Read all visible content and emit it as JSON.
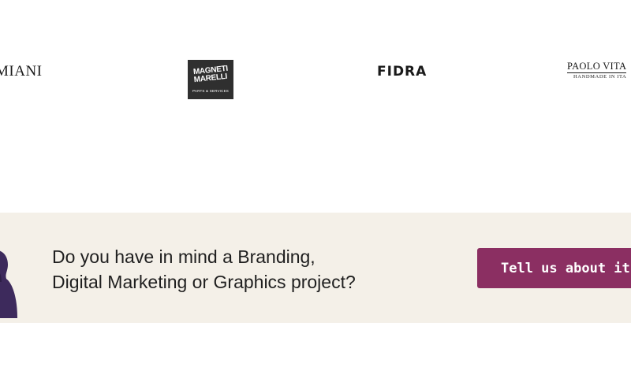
{
  "logos": {
    "miani": "MIANI",
    "magneti_marelli": {
      "line1": "MAGNETI",
      "line2": "MARELLI",
      "sub": "PARTS & SERVICES"
    },
    "fidra": "FIDRA",
    "paolo_vitale": {
      "name": "PAOLO VITA",
      "sub": "HANDMADE IN ITA"
    }
  },
  "cta": {
    "line1": "Do you have in mind a Branding,",
    "line2": "Digital Marketing or Graphics project?",
    "button_label": "Tell us about it"
  },
  "colors": {
    "banner_background": "#f4f0e8",
    "button_background": "#8b2f62",
    "person_figure": "#3d2a5c"
  }
}
